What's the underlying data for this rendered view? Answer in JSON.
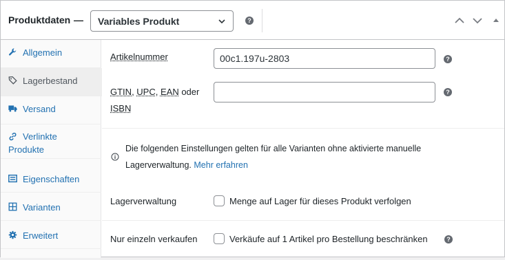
{
  "header": {
    "title": "Produktdaten",
    "dash": "—",
    "product_type": "Variables Produkt",
    "help_symbol": "?"
  },
  "sidebar": {
    "items": [
      {
        "label": "Allgemein",
        "icon": "wrench-icon"
      },
      {
        "label": "Lagerbestand",
        "icon": "tag-icon"
      },
      {
        "label": "Versand",
        "icon": "truck-icon"
      },
      {
        "label": "Verlinkte Produkte",
        "label_line1": "Verlinkte",
        "label_line2": "Produkte",
        "icon": "link-icon"
      },
      {
        "label": "Eigenschaften",
        "icon": "list-icon"
      },
      {
        "label": "Varianten",
        "icon": "grid-icon"
      },
      {
        "label": "Erweitert",
        "icon": "gear-icon"
      }
    ],
    "active": "Lagerbestand"
  },
  "inventory": {
    "sku_label": "Artikelnummer",
    "sku_value": "00c1.197u-2803",
    "gtin_label": {
      "gtin": "GTIN",
      "sep1": ", ",
      "upc": "UPC",
      "sep2": ", ",
      "ean": "EAN",
      "oder": " oder",
      "isbn": "ISBN"
    },
    "gtin_value": "",
    "notice_text": "Die folgenden Einstellungen gelten für alle Varianten ohne aktivierte manuelle",
    "notice_text2": "Lagerverwaltung.",
    "notice_link": "Mehr erfahren",
    "manage_stock_label": "Lagerverwaltung",
    "manage_stock_cb_label": "Menge auf Lager für dieses Produkt verfolgen",
    "sold_individually_label": "Nur einzeln verkaufen",
    "sold_individually_cb_label": "Verkäufe auf 1 Artikel pro Bestellung beschränken"
  },
  "colors": {
    "link": "#2271b1",
    "border": "#c3c4c7",
    "help_bg": "#646970"
  }
}
